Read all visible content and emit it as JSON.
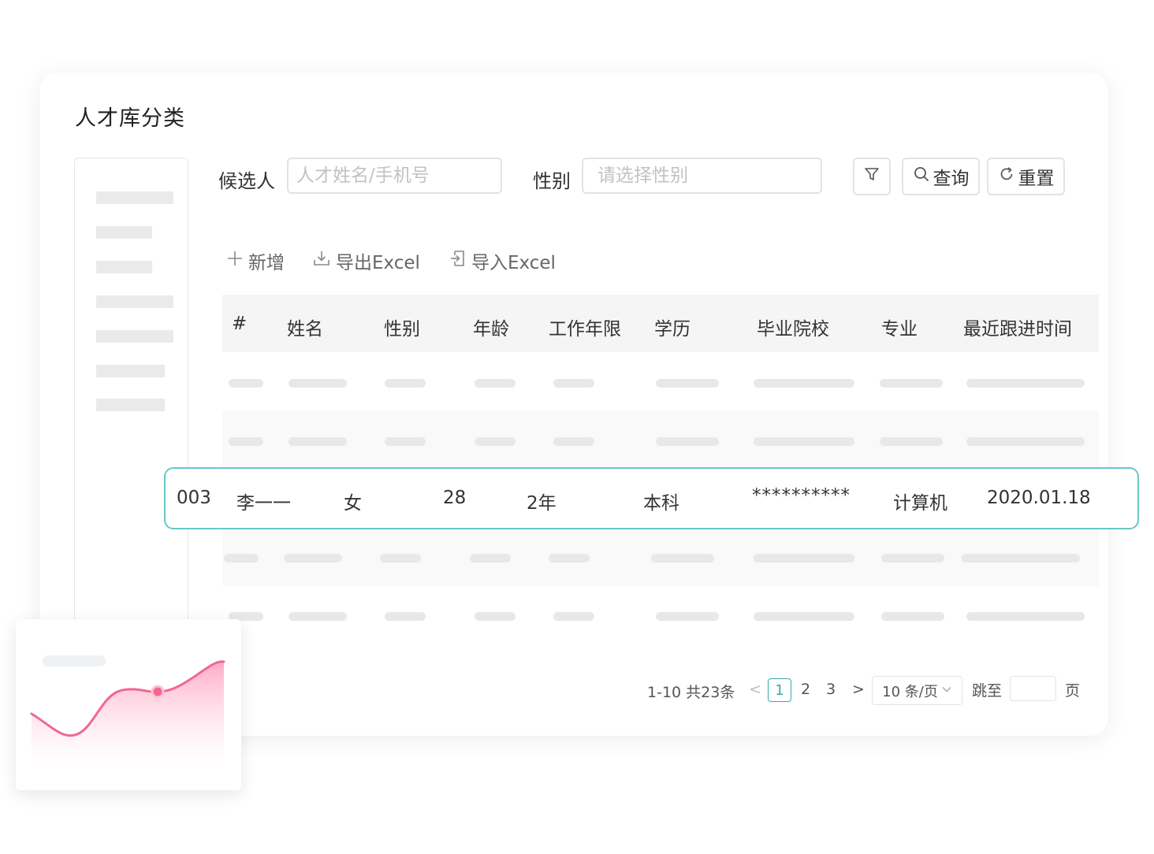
{
  "page": {
    "title": "人才库分类"
  },
  "filters": {
    "candidate_label": "候选人",
    "candidate_placeholder": "人才姓名/手机号",
    "gender_label": "性别",
    "gender_placeholder": "请选择性别",
    "query_label": "查询",
    "reset_label": "重置"
  },
  "toolbar": {
    "add_label": "新增",
    "export_label": "导出Excel",
    "import_label": "导入Excel"
  },
  "table": {
    "columns": [
      "#",
      "姓名",
      "性别",
      "年龄",
      "工作年限",
      "学历",
      "毕业院校",
      "专业",
      "最近跟进时间"
    ],
    "highlighted_row": {
      "id": "003",
      "name": "李一一",
      "gender": "女",
      "age": "28",
      "years": "2年",
      "education": "本科",
      "school": "**********",
      "major": "计算机",
      "last_follow": "2020.01.18"
    }
  },
  "pagination": {
    "summary": "1-10 共23条",
    "pages": [
      "1",
      "2",
      "3"
    ],
    "current": "1",
    "page_size": "10 条/页",
    "jump_label": "跳至",
    "page_suffix": "页"
  },
  "colors": {
    "accent": "#3aa9a8",
    "row_border": "#67c8c7",
    "chart_line": "#f06892",
    "chart_fill": "#ffd6e2"
  },
  "icons": {
    "filter": "funnel-icon",
    "query": "search-icon",
    "reset": "refresh-icon",
    "add": "plus-icon",
    "export": "download-icon",
    "import": "import-icon"
  }
}
